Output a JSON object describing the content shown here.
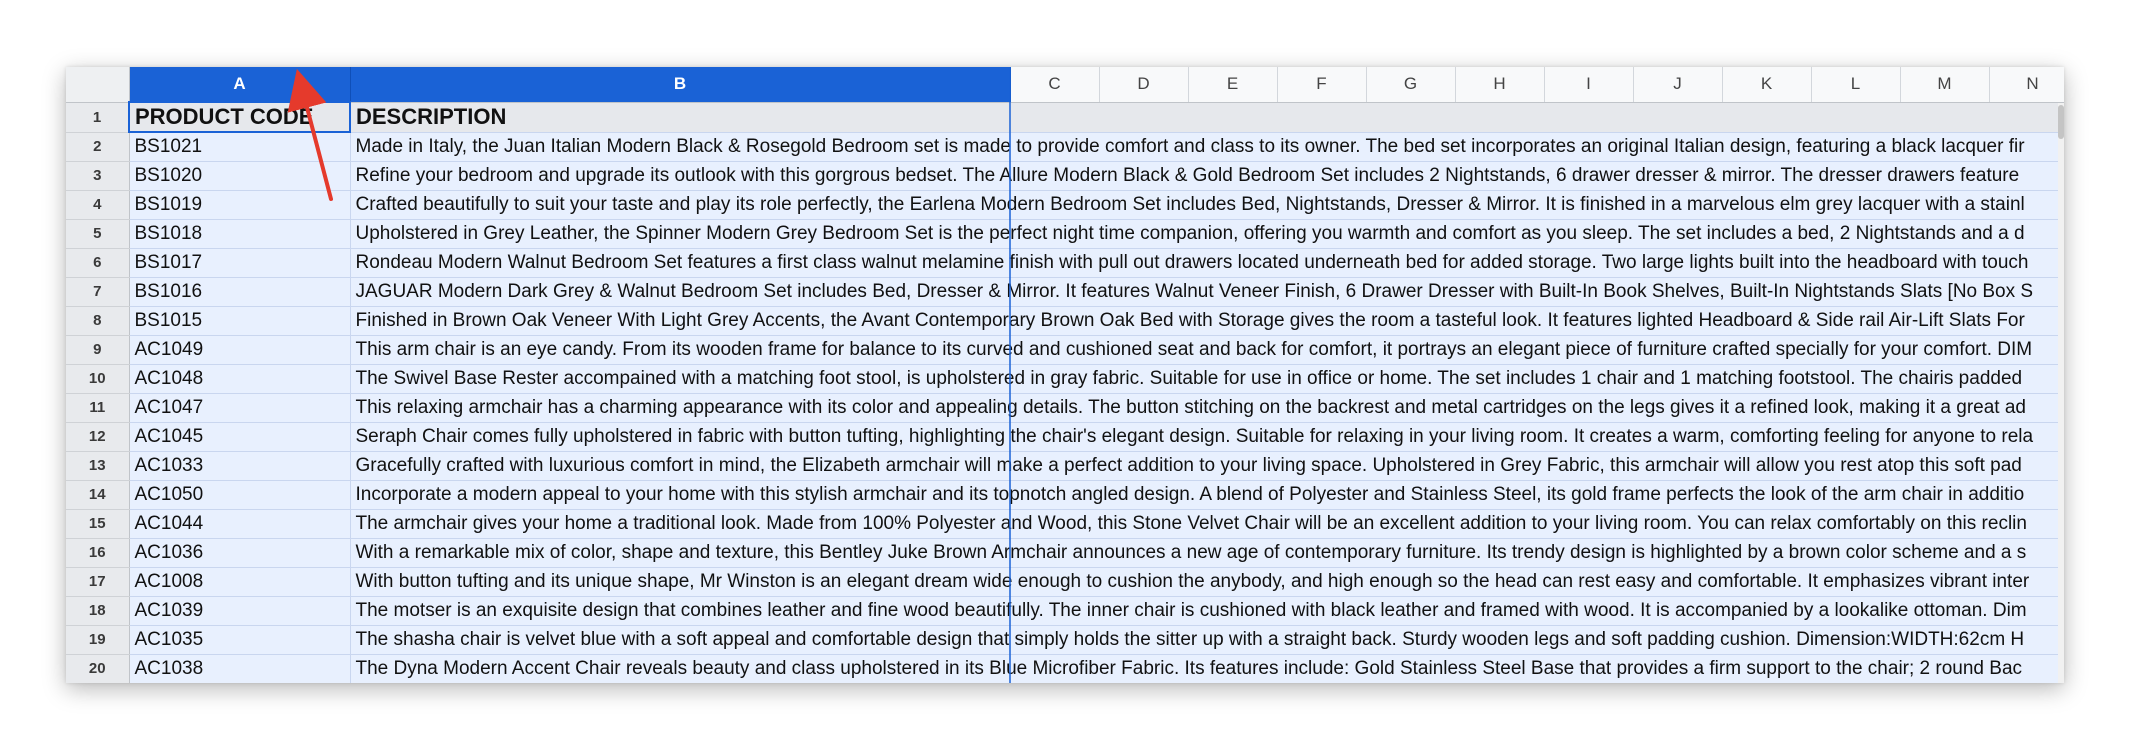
{
  "columns": [
    "A",
    "B",
    "C",
    "D",
    "E",
    "F",
    "G",
    "H",
    "I",
    "J",
    "K",
    "L",
    "M",
    "N"
  ],
  "selected_columns": [
    "A",
    "B"
  ],
  "colors": {
    "selection_header": "#1a62d6",
    "selection_fill": "#e8f0fe",
    "annotation_arrow": "#e53a2c"
  },
  "rows": [
    {
      "n": "1",
      "a": "PRODUCT CODE",
      "b": "DESCRIPTION"
    },
    {
      "n": "2",
      "a": "BS1021",
      "b": "Made in Italy, the Juan Italian Modern Black & Rosegold Bedroom set is made to provide comfort and class to its owner. The bed set incorporates an original Italian design, featuring a black lacquer fir"
    },
    {
      "n": "3",
      "a": "BS1020",
      "b": "Refine your bedroom and upgrade its outlook with this gorgrous bedset. The Allure Modern Black & Gold Bedroom Set includes 2 Nightstands, 6 drawer dresser & mirror. The dresser drawers feature"
    },
    {
      "n": "4",
      "a": "BS1019",
      "b": "Crafted beautifully to suit your taste and play its role perfectly, the Earlena Modern Bedroom Set includes Bed, Nightstands, Dresser & Mirror. It is finished in a marvelous elm grey lacquer with a stainl"
    },
    {
      "n": "5",
      "a": "BS1018",
      "b": "Upholstered in Grey Leather, the Spinner Modern Grey Bedroom Set is the perfect night time companion, offering you warmth and comfort as you sleep. The set includes a bed, 2 Nightstands and a d"
    },
    {
      "n": "6",
      "a": "BS1017",
      "b": "Rondeau Modern Walnut Bedroom Set features a first class walnut melamine finish with pull out drawers located underneath bed for added storage. Two large lights built into the headboard with touch"
    },
    {
      "n": "7",
      "a": "BS1016",
      "b": "JAGUAR Modern Dark Grey & Walnut Bedroom Set includes Bed, Dresser & Mirror. It features Walnut Veneer Finish, 6 Drawer Dresser with Built-In Book Shelves, Built-In Nightstands Slats [No Box S"
    },
    {
      "n": "8",
      "a": "BS1015",
      "b": "Finished in Brown Oak Veneer With Light Grey Accents, the Avant Contemporary Brown Oak Bed with Storage gives the room a tasteful look. It features lighted Headboard & Side rail Air-Lift Slats For"
    },
    {
      "n": "9",
      "a": "AC1049",
      "b": "This arm chair is an eye candy. From its wooden frame for balance to its curved and cushioned seat and back for comfort, it portrays an elegant piece of furniture crafted specially for your comfort. DIM"
    },
    {
      "n": "10",
      "a": "AC1048",
      "b": "The Swivel Base Rester accompained with a matching foot stool, is upholstered in gray fabric. Suitable for use in office or home. The set includes 1 chair and 1 matching footstool. The chairis padded"
    },
    {
      "n": "11",
      "a": "AC1047",
      "b": "This relaxing armchair has a charming appearance with its color and appealing details. The button stitching on the backrest and metal cartridges on the legs gives it a refined look, making it a great ad"
    },
    {
      "n": "12",
      "a": "AC1045",
      "b": "Seraph Chair comes fully upholstered in fabric with button tufting, highlighting the chair's elegant design. Suitable for relaxing in your living room. It creates a warm, comforting feeling for anyone to rela"
    },
    {
      "n": "13",
      "a": "AC1033",
      "b": "Gracefully crafted with luxurious comfort in mind, the Elizabeth armchair will make a perfect addition to your living space. Upholstered in Grey Fabric, this armchair will allow you rest atop this soft pad"
    },
    {
      "n": "14",
      "a": "AC1050",
      "b": "Incorporate a modern appeal to your home with this stylish armchair and its topnotch angled design. A blend of Polyester and Stainless Steel, its gold frame perfects the look of the arm chair in additio"
    },
    {
      "n": "15",
      "a": "AC1044",
      "b": "The armchair gives your home a traditional look. Made from 100% Polyester and Wood, this Stone Velvet Chair will be an excellent addition to your living room. You can relax comfortably on this reclin"
    },
    {
      "n": "16",
      "a": "AC1036",
      "b": "With a remarkable mix of color, shape and texture, this Bentley Juke Brown Armchair announces a new age of contemporary furniture. Its trendy design is highlighted by a brown color scheme and a s"
    },
    {
      "n": "17",
      "a": "AC1008",
      "b": "With button tufting and its unique shape, Mr Winston is an elegant dream wide enough to cushion the anybody, and high enough so the head can rest easy and comfortable. It emphasizes vibrant inter"
    },
    {
      "n": "18",
      "a": "AC1039",
      "b": "The motser is an exquisite design that combines leather and fine wood beautifully. The inner chair is cushioned with black leather and framed with wood. It is accompanied by a lookalike ottoman. Dim"
    },
    {
      "n": "19",
      "a": "AC1035",
      "b": "The shasha chair is velvet blue with a soft appeal and comfortable design that simply holds the sitter up with a straight back. Sturdy wooden legs and soft padding cushion. Dimension:WIDTH:62cm H"
    },
    {
      "n": "20",
      "a": "AC1038",
      "b": "The Dyna Modern Accent Chair reveals beauty and class upholstered in its Blue Microfiber Fabric. Its features include: Gold Stainless Steel Base that provides a firm support to the chair; 2 round Bac"
    }
  ]
}
